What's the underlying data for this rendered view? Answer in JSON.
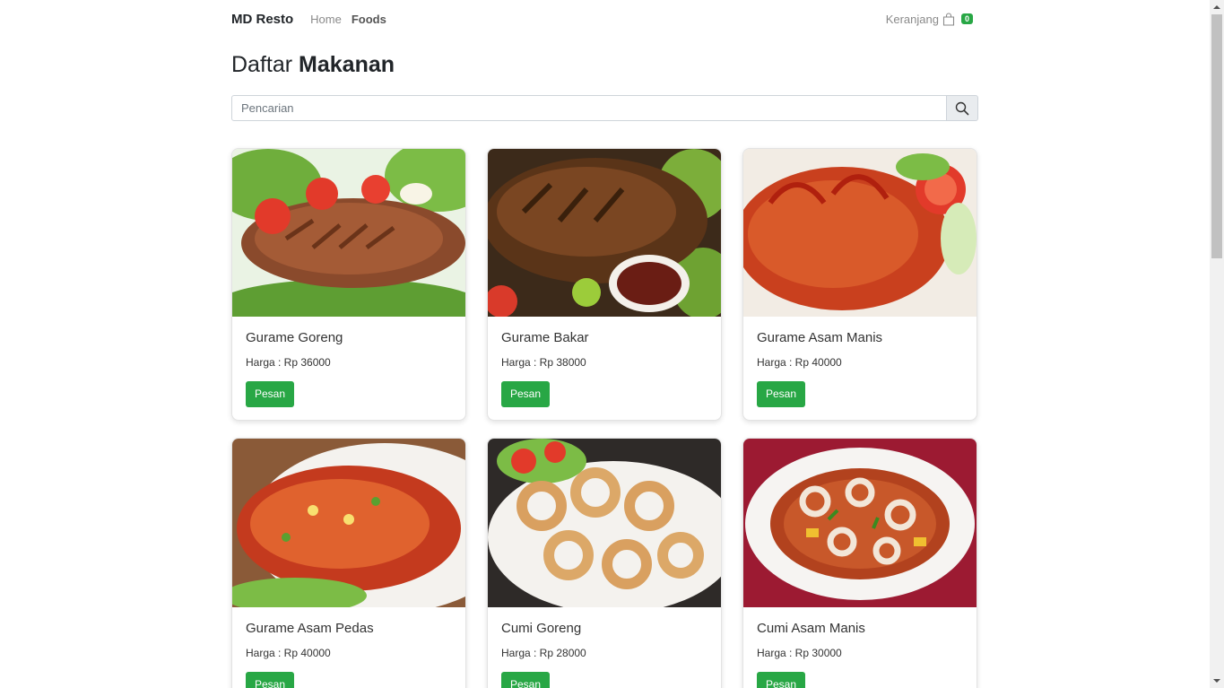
{
  "navbar": {
    "brand": "MD Resto",
    "links": [
      {
        "label": "Home",
        "active": false
      },
      {
        "label": "Foods",
        "active": true
      }
    ],
    "cart_label": "Keranjang",
    "cart_count": "0"
  },
  "page": {
    "title_light": "Daftar",
    "title_bold": "Makanan"
  },
  "search": {
    "placeholder": "Pencarian"
  },
  "foods": [
    {
      "name": "Gurame Goreng",
      "price": "Harga : Rp 36000",
      "button": "Pesan",
      "image": "fried-fish-photo"
    },
    {
      "name": "Gurame Bakar",
      "price": "Harga : Rp 38000",
      "button": "Pesan",
      "image": "grilled-fish-photo"
    },
    {
      "name": "Gurame Asam Manis",
      "price": "Harga : Rp 40000",
      "button": "Pesan",
      "image": "sweet-sour-fish-photo"
    },
    {
      "name": "Gurame Asam Pedas",
      "price": "Harga : Rp 40000",
      "button": "Pesan",
      "image": "spicy-fish-photo"
    },
    {
      "name": "Cumi Goreng",
      "price": "Harga : Rp 28000",
      "button": "Pesan",
      "image": "fried-squid-photo"
    },
    {
      "name": "Cumi Asam Manis",
      "price": "Harga : Rp 30000",
      "button": "Pesan",
      "image": "sweet-sour-squid-photo"
    }
  ],
  "colors": {
    "accent_green": "#28a745",
    "text_dark": "#212529",
    "text_muted": "#8a8a8a"
  }
}
